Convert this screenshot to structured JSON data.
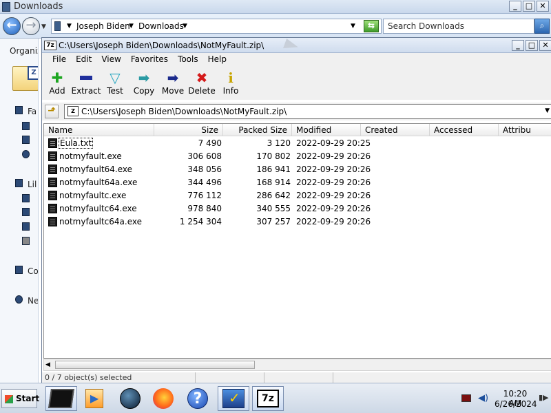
{
  "explorer": {
    "title": "Downloads",
    "breadcrumb": [
      "Joseph Biden",
      "Downloads"
    ],
    "search_placeholder": "Search Downloads",
    "organize_label": "Organiz",
    "nav_items": [
      "Fa",
      "Lil",
      "Co",
      "Ne"
    ],
    "window_buttons": {
      "minimize": "_",
      "maximize": "□",
      "close": "✕"
    }
  },
  "zip": {
    "title": "C:\\Users\\Joseph Biden\\Downloads\\NotMyFault.zip\\",
    "path": "C:\\Users\\Joseph Biden\\Downloads\\NotMyFault.zip\\",
    "menu": [
      "File",
      "Edit",
      "View",
      "Favorites",
      "Tools",
      "Help"
    ],
    "toolbar": [
      {
        "label": "Add",
        "icon": "add-icon"
      },
      {
        "label": "Extract",
        "icon": "extract-icon"
      },
      {
        "label": "Test",
        "icon": "test-icon"
      },
      {
        "label": "Copy",
        "icon": "copy-icon"
      },
      {
        "label": "Move",
        "icon": "move-icon"
      },
      {
        "label": "Delete",
        "icon": "delete-icon"
      },
      {
        "label": "Info",
        "icon": "info-icon"
      }
    ],
    "columns": [
      "Name",
      "Size",
      "Packed Size",
      "Modified",
      "Created",
      "Accessed",
      "Attribu"
    ],
    "files": [
      {
        "name": "Eula.txt",
        "size": "7 490",
        "packed": "3 120",
        "modified": "2022-09-29 20:25"
      },
      {
        "name": "notmyfault.exe",
        "size": "306 608",
        "packed": "170 802",
        "modified": "2022-09-29 20:26"
      },
      {
        "name": "notmyfault64.exe",
        "size": "348 056",
        "packed": "186 941",
        "modified": "2022-09-29 20:26"
      },
      {
        "name": "notmyfault64a.exe",
        "size": "344 496",
        "packed": "168 914",
        "modified": "2022-09-29 20:26"
      },
      {
        "name": "notmyfaultc.exe",
        "size": "776 112",
        "packed": "286 642",
        "modified": "2022-09-29 20:26"
      },
      {
        "name": "notmyfaultc64.exe",
        "size": "978 840",
        "packed": "340 555",
        "modified": "2022-09-29 20:26"
      },
      {
        "name": "notmyfaultc64a.exe",
        "size": "1 254 304",
        "packed": "307 257",
        "modified": "2022-09-29 20:26"
      }
    ],
    "status": "0 / 7 object(s) selected"
  },
  "taskbar": {
    "start_label": "Start",
    "seven_zip_label": "7z",
    "help_label": "?",
    "time": "10:20 AM",
    "date": "6/26/2024"
  }
}
